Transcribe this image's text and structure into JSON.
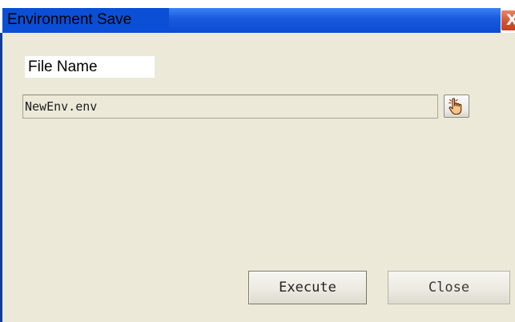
{
  "window": {
    "title": "Environment Save",
    "close_glyph": "X"
  },
  "form": {
    "file_name_label": "File Name",
    "file_name_value": "NewEnv.env",
    "browse_icon": "pointing-hand-icon"
  },
  "actions": {
    "execute_label": "Execute",
    "close_label": "Close"
  },
  "colors": {
    "titlebar_blue": "#0a4fd6",
    "close_red": "#d2502c",
    "dialog_background": "#ece9d8"
  }
}
